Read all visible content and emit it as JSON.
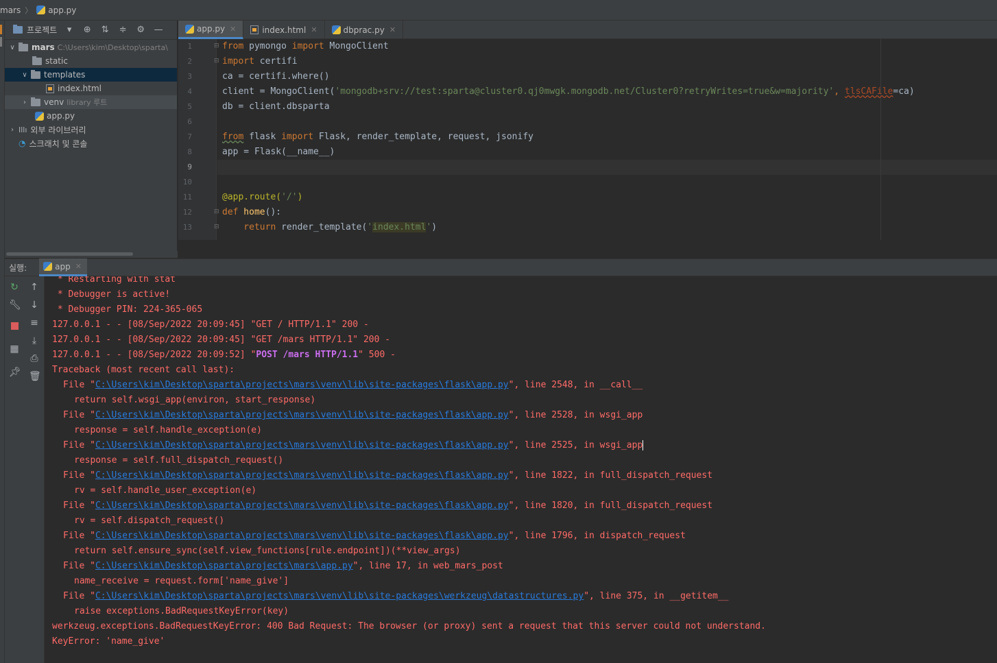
{
  "breadcrumb": {
    "project": "mars",
    "file": "app.py"
  },
  "project_panel": {
    "title": "프로젝트",
    "tree": [
      {
        "label": "mars",
        "path": "C:\\Users\\kim\\Desktop\\sparta\\"
      },
      {
        "label": "static"
      },
      {
        "label": "templates"
      },
      {
        "label": "index.html"
      },
      {
        "label": "venv",
        "note": "library 루트"
      },
      {
        "label": "app.py"
      },
      {
        "label": "외부 라이브러리"
      },
      {
        "label": "스크래치 및 콘솔"
      }
    ]
  },
  "editor": {
    "tabs": [
      {
        "label": "app.py",
        "icon": "python-file-icon",
        "active": true
      },
      {
        "label": "index.html",
        "icon": "html-file-icon",
        "active": false
      },
      {
        "label": "dbprac.py",
        "icon": "python-file-icon",
        "active": false
      }
    ],
    "line_numbers": [
      "1",
      "2",
      "3",
      "4",
      "5",
      "6",
      "7",
      "8",
      "9",
      "10",
      "11",
      "12",
      "13"
    ],
    "code": {
      "l1": {
        "kw1": "from",
        "mod": " pymongo ",
        "kw2": "import",
        "rest": " MongoClient"
      },
      "l2": {
        "kw1": "import",
        "rest": " certifi"
      },
      "l3": "ca = certifi.where()",
      "l4": {
        "pre": "client = MongoClient(",
        "str": "'mongodb+srv://test:sparta@cluster0.qj0mwgk.mongodb.net/Cluster0?retryWrites=true&w=majority'",
        "mid": ", ",
        "param": "tlsCAFile",
        "post": "=ca)"
      },
      "l5": "db = client.dbsparta",
      "l7": {
        "kw1": "from",
        "mod": " flask ",
        "kw2": "import",
        "rest": " Flask, render_template, request, jsonify"
      },
      "l8": "app = Flask(__name__)",
      "l11": {
        "deco": "@app.route(",
        "str": "'/'",
        "post": ")"
      },
      "l12": {
        "kw": "def",
        "fn": " home",
        "post": "():"
      },
      "l13": {
        "kw": "    return",
        "pre": " render_template(",
        "q1": "'",
        "str": "index.html",
        "q2": "'",
        "post": ")"
      }
    }
  },
  "run_panel": {
    "label": "실행:",
    "tab": "app",
    "console": {
      "c1": " * Restarting with stat",
      "c2": " * Debugger is active!",
      "c3": " * Debugger PIN: 224-365-065",
      "c4": "127.0.0.1 - - [08/Sep/2022 20:09:45] \"GET / HTTP/1.1\" 200 -",
      "c5": "127.0.0.1 - - [08/Sep/2022 20:09:45] \"GET /mars HTTP/1.1\" 200 -",
      "c6_pre": "127.0.0.1 - - [08/Sep/2022 20:09:52] \"",
      "c6_bold": "POST /mars HTTP/1.1",
      "c6_post": "\" 500 -",
      "c7": "Traceback (most recent call last):",
      "flask_app_path": "C:\\Users\\kim\\Desktop\\sparta\\projects\\mars\\venv\\lib\\site-packages\\flask\\app.py",
      "mars_app_path": "C:\\Users\\kim\\Desktop\\sparta\\projects\\mars\\app.py",
      "werkzeug_path": "C:\\Users\\kim\\Desktop\\sparta\\projects\\mars\\venv\\lib\\site-packages\\werkzeug\\datastructures.py",
      "file_pre": "File \"",
      "f1_post": "\", line 2548, in __call__",
      "f1_code": "return self.wsgi_app(environ, start_response)",
      "f2_post": "\", line 2528, in wsgi_app",
      "f2_code": "response = self.handle_exception(e)",
      "f3_post": "\", line 2525, in wsgi_app",
      "f3_code": "response = self.full_dispatch_request()",
      "f4_post": "\", line 1822, in full_dispatch_request",
      "f4_code": "rv = self.handle_user_exception(e)",
      "f5_post": "\", line 1820, in full_dispatch_request",
      "f5_code": "rv = self.dispatch_request()",
      "f6_post": "\", line 1796, in dispatch_request",
      "f6_code": "return self.ensure_sync(self.view_functions[rule.endpoint])(**view_args)",
      "f7_post": "\", line 17, in web_mars_post",
      "f7_code": "name_receive = request.form['name_give']",
      "f8_post": "\", line 375, in __getitem__",
      "f8_code": "raise exceptions.BadRequestKeyError(key)",
      "err1": "werkzeug.exceptions.BadRequestKeyError: 400 Bad Request: The browser (or proxy) sent a request that this server could not understand.",
      "err2": "KeyError: 'name_give'"
    }
  },
  "colors": {
    "keyword": "#cc7832",
    "string": "#6a8759",
    "console_error": "#ff6b68",
    "console_link": "#287bde",
    "selection": "#0d293e"
  }
}
